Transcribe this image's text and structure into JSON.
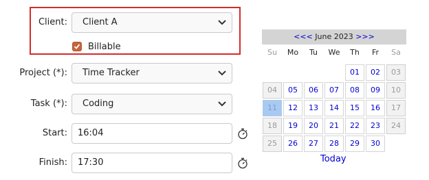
{
  "form": {
    "client_label": "Client:",
    "client_value": "Client A",
    "billable_label": "Billable",
    "billable_checked": true,
    "project_label": "Project (*):",
    "project_value": "Time Tracker",
    "task_label": "Task (*):",
    "task_value": "Coding",
    "start_label": "Start:",
    "start_value": "16:04",
    "finish_label": "Finish:",
    "finish_value": "17:30"
  },
  "calendar": {
    "prev": "<<<",
    "month_year": "June 2023",
    "next": ">>>",
    "weekdays": [
      "Su",
      "Mo",
      "Tu",
      "We",
      "Th",
      "Fr",
      "Sa"
    ],
    "today_label": "Today",
    "selected_day": "11",
    "weeks": [
      [
        "",
        "",
        "",
        "",
        "01",
        "02",
        "03"
      ],
      [
        "04",
        "05",
        "06",
        "07",
        "08",
        "09",
        "10"
      ],
      [
        "11",
        "12",
        "13",
        "14",
        "15",
        "16",
        "17"
      ],
      [
        "18",
        "19",
        "20",
        "21",
        "22",
        "23",
        "24"
      ],
      [
        "25",
        "26",
        "27",
        "28",
        "29",
        "30",
        ""
      ]
    ]
  },
  "colors": {
    "highlight": "#d42a2a",
    "link": "#0000d0",
    "checkbox": "#c8633a",
    "selected_day": "#a9c9f0"
  }
}
